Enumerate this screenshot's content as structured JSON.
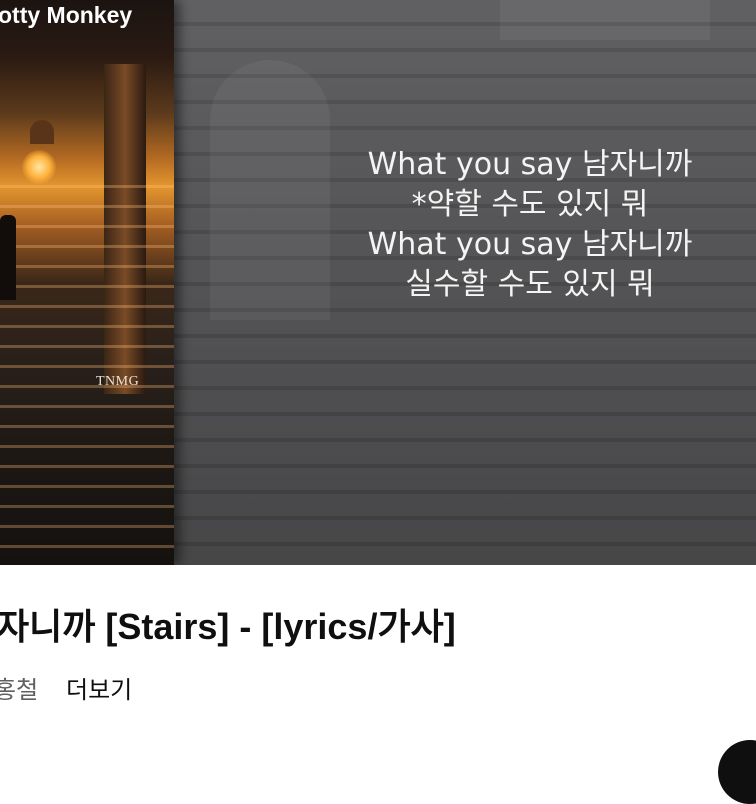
{
  "video": {
    "album_art": {
      "title": "otty Monkey",
      "label": "TNMG"
    },
    "lyrics": [
      "What you say 남자니까",
      "*약할 수도 있지 뭐",
      "What you say 남자니까",
      "실수할 수도 있지 뭐"
    ]
  },
  "info": {
    "title": "자니까 [Stairs] - [lyrics/가사]",
    "channel": "홍철",
    "more_label": "더보기"
  }
}
